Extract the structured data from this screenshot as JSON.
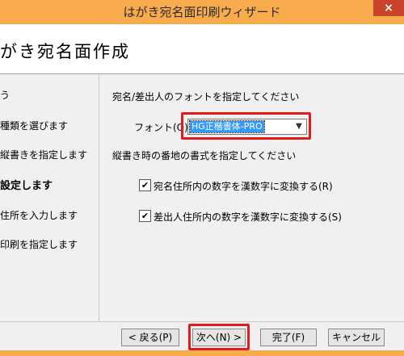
{
  "window": {
    "title": "はがき宛名面印刷ウィザード",
    "close_glyph": "×"
  },
  "header": {
    "title": "がき宛名面作成"
  },
  "steps": [
    {
      "label": "う"
    },
    {
      "label": "種類を選びます"
    },
    {
      "label": "縦書きを指定します"
    },
    {
      "label": "設定します"
    },
    {
      "label": "住所を入力します"
    },
    {
      "label": "印刷を指定します"
    }
  ],
  "main": {
    "font_section_label": "宛名/差出人のフォントを指定してください",
    "font_label": "フォント(O):",
    "font_value": "HG正楷書体-PRO",
    "address_section_label": "縦書き時の番地の書式を指定してください",
    "checkbox1_label": "宛名住所内の数字を漢数字に変換する(R)",
    "checkbox1_checked": true,
    "checkbox2_label": "差出人住所内の数字を漢数字に変換する(S)",
    "checkbox2_checked": true
  },
  "buttons": {
    "back": "< 戻る(P)",
    "next": "次へ(N) >",
    "finish": "完了(F)",
    "cancel": "キャンセル"
  },
  "icons": {
    "checkmark": "✔",
    "dropdown": "chevron-down-icon"
  },
  "colors": {
    "titlebar": "#f8ab4d",
    "highlight": "#e01c1c",
    "selection": "#3399ff"
  }
}
